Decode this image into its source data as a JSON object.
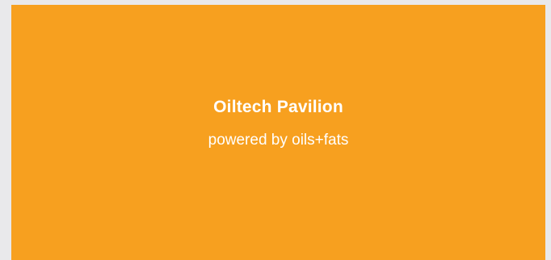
{
  "banner": {
    "title": "Oiltech Pavilion",
    "subtitle": "powered by oils+fats",
    "background_color": "#f7a01f",
    "text_color": "#ffffff"
  },
  "page": {
    "background_color": "#e9e9eb"
  }
}
